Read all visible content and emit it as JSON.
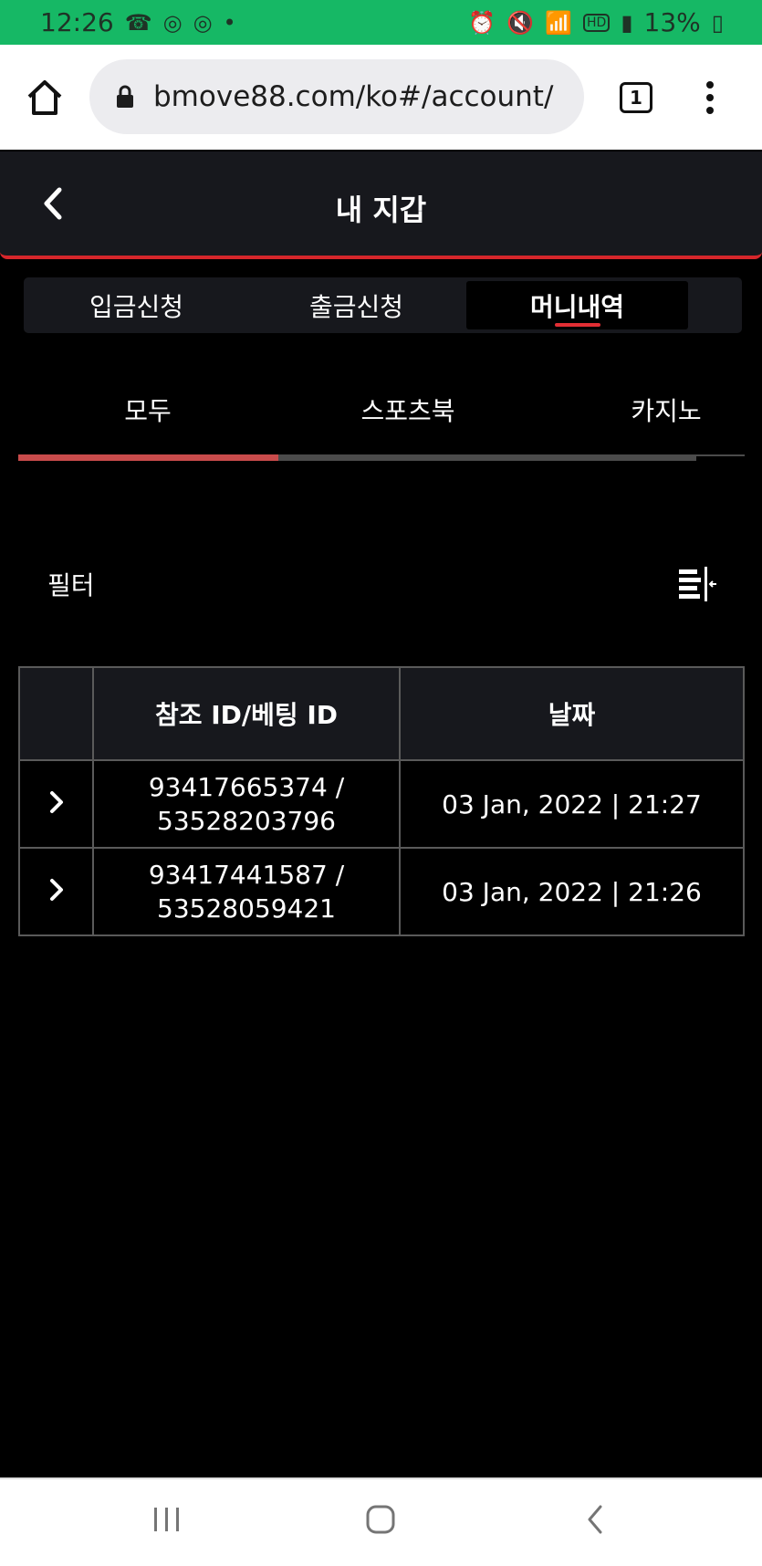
{
  "status": {
    "time": "12:26",
    "battery": "13%",
    "icons": [
      "phone-icon",
      "instagram-icon",
      "instagram-icon",
      "notification-dot-icon",
      "alarm-icon",
      "mute-icon",
      "wifi-icon",
      "hd-icon",
      "signal-icon",
      "battery-icon"
    ],
    "hd_label": "HD"
  },
  "browser": {
    "url": "bmove88.com/ko#/account/",
    "tab_count": "1"
  },
  "header": {
    "title": "내 지갑"
  },
  "wallet_tabs": [
    {
      "label": "입금신청"
    },
    {
      "label": "출금신청"
    },
    {
      "label": "머니내역"
    }
  ],
  "sub_tabs": [
    {
      "label": "모두"
    },
    {
      "label": "스포츠북"
    },
    {
      "label": "카지노"
    }
  ],
  "filter": {
    "label": "필터"
  },
  "table": {
    "headers": [
      "",
      "참조 ID/베팅 ID",
      "날짜"
    ],
    "rows": [
      {
        "id_line1": "93417665374 /",
        "id_line2": "53528203796",
        "date": "03 Jan, 2022 | 21:27"
      },
      {
        "id_line1": "93417441587 /",
        "id_line2": "53528059421",
        "date": "03 Jan, 2022 | 21:26"
      }
    ]
  },
  "colors": {
    "status_bar": "#16b865",
    "accent": "#d6262b",
    "surface": "#17181d",
    "background": "#000000"
  }
}
